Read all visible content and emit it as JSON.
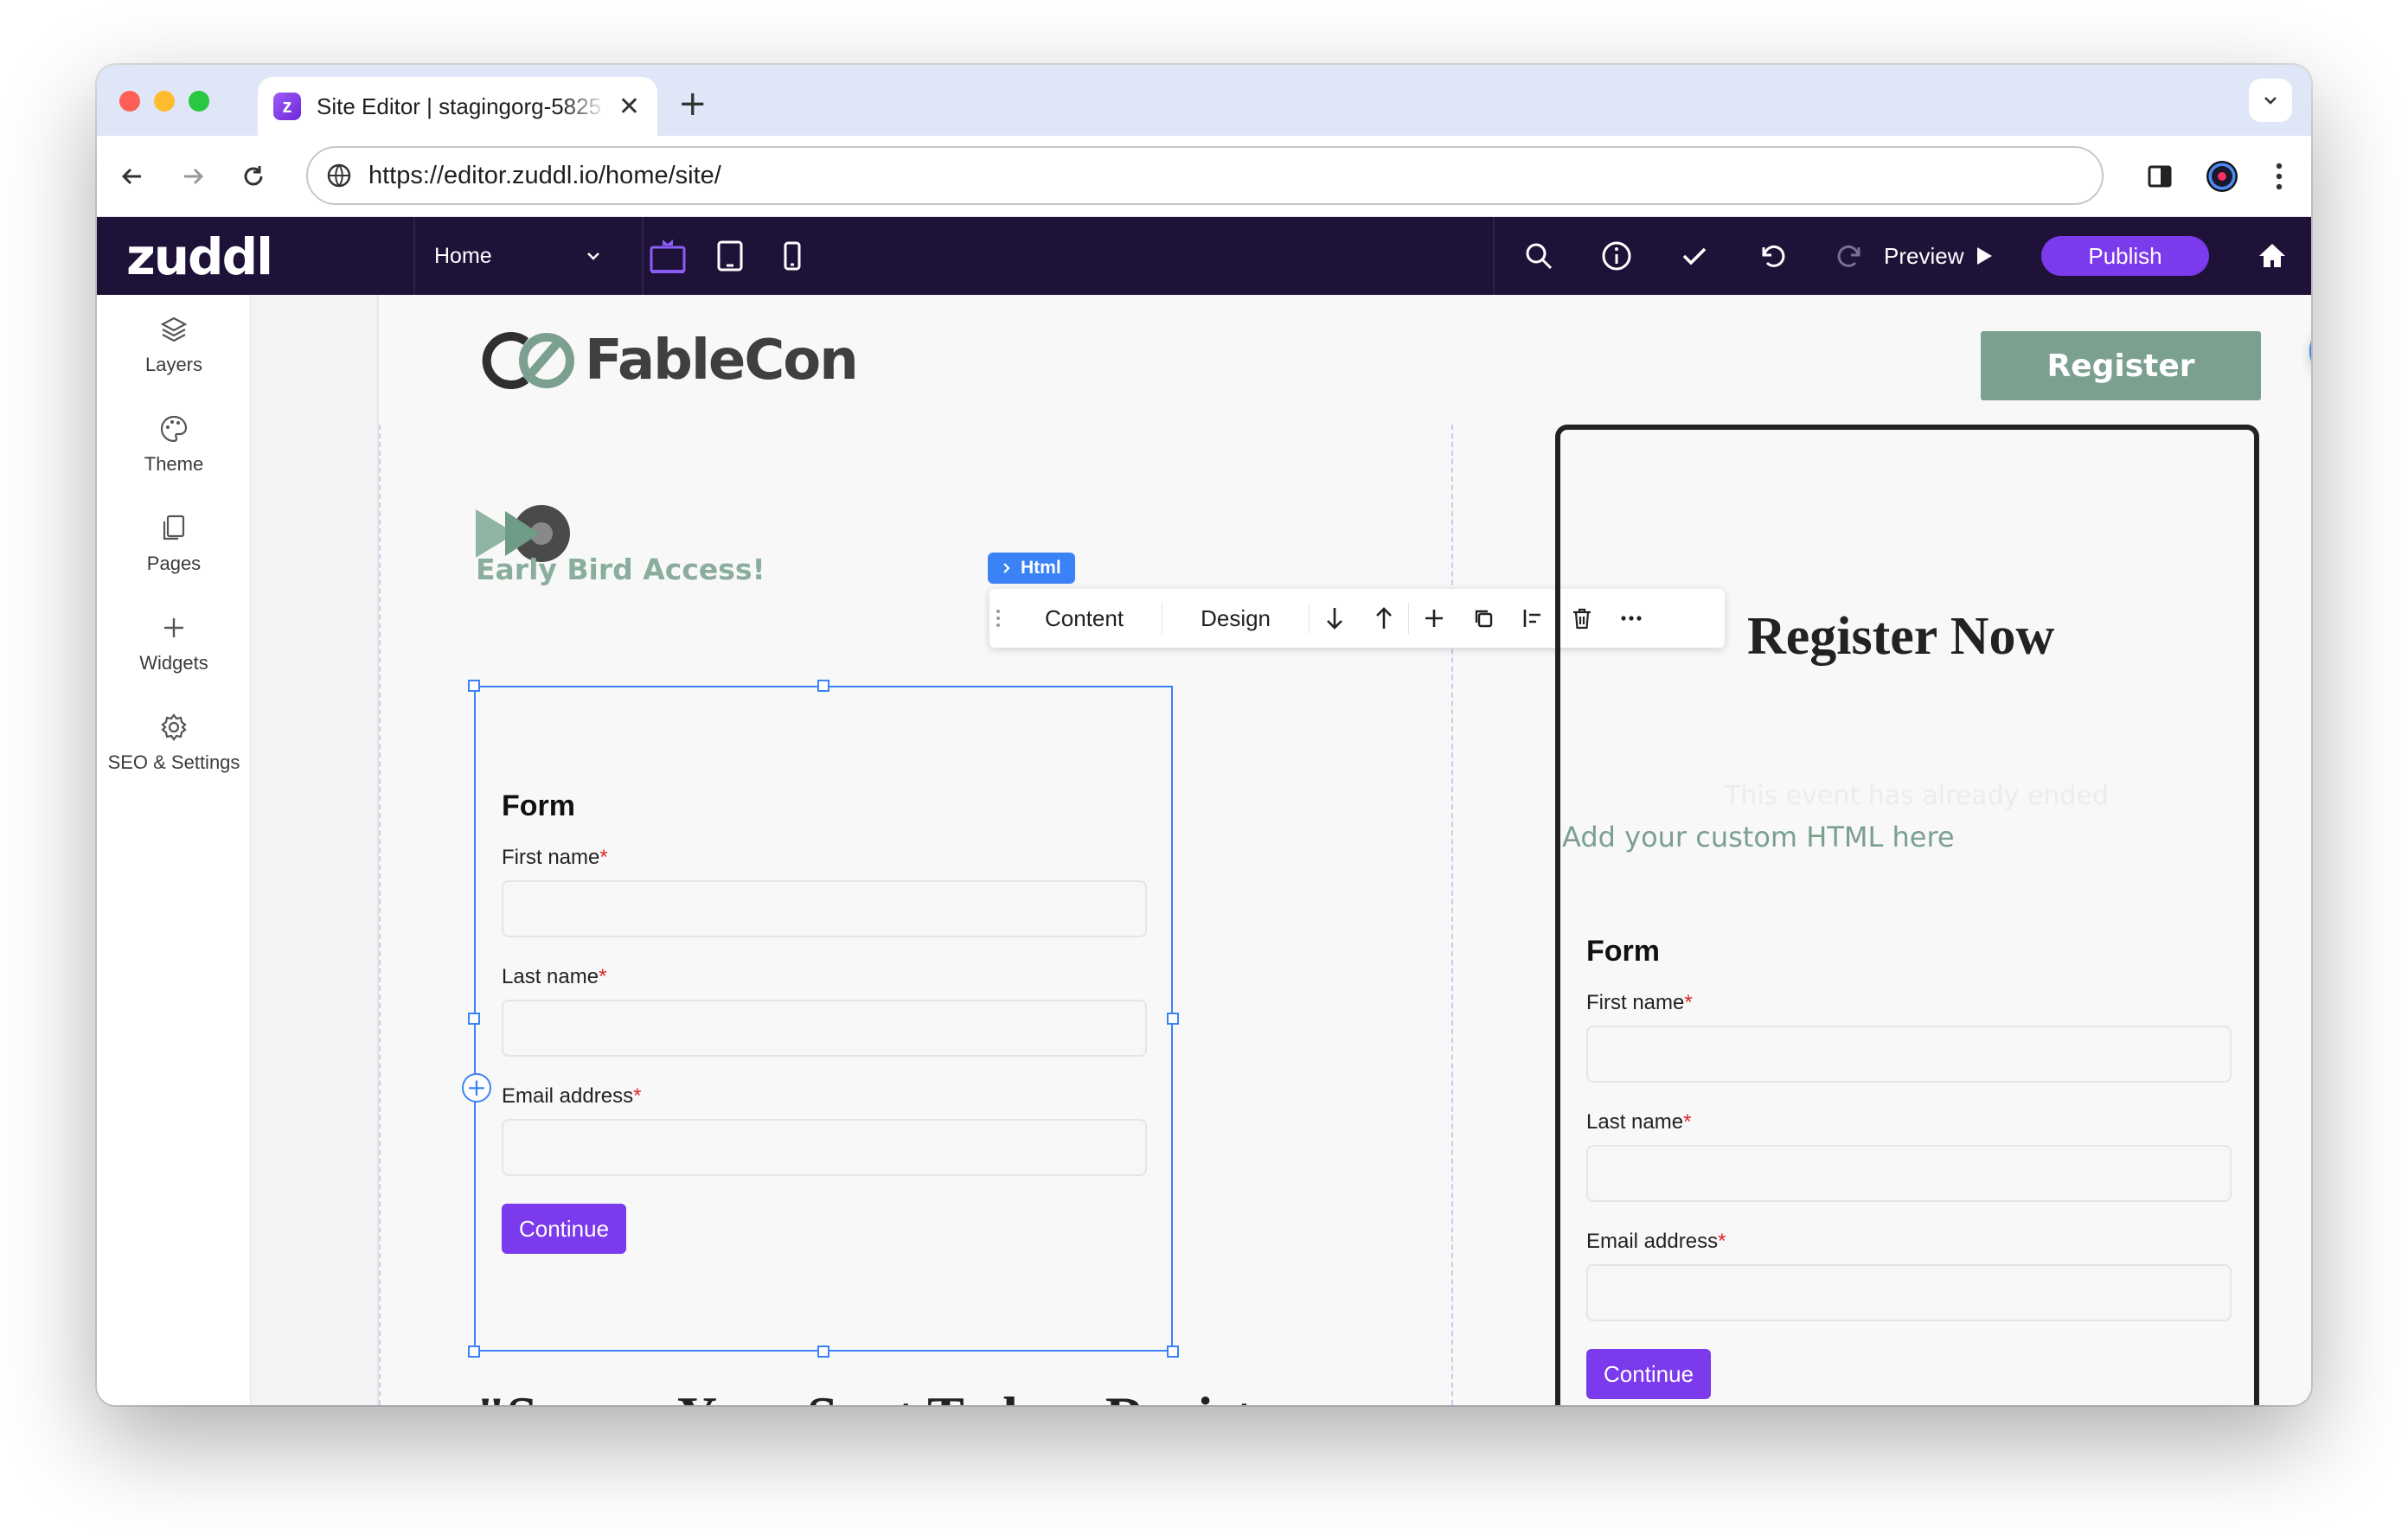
{
  "browser": {
    "tab_title": "Site Editor | stagingorg-5825",
    "url": "https://editor.zuddl.io/home/site/"
  },
  "app": {
    "logo": "zuddl",
    "page_select": "Home",
    "preview_label": "Preview",
    "publish_label": "Publish",
    "accent_color": "#7c3aed",
    "header_color": "#1f1238"
  },
  "sidebar": {
    "items": [
      {
        "label": "Layers",
        "icon": "layers-icon"
      },
      {
        "label": "Theme",
        "icon": "palette-icon"
      },
      {
        "label": "Pages",
        "icon": "pages-icon"
      },
      {
        "label": "Widgets",
        "icon": "plus-icon"
      },
      {
        "label": "SEO & Settings",
        "icon": "gear-icon"
      }
    ]
  },
  "site": {
    "brand": "FableCon",
    "register_button": "Register",
    "early_bird": "Early Bird Access!",
    "headline": "\"Secure Your Spot Today: Register",
    "register_now": "Register Now",
    "event_ended": "This event has already ended",
    "custom_html": "Add your custom HTML here",
    "brand_color": "#7ba08f"
  },
  "editor": {
    "element_tag": "Html",
    "tabs": [
      "Content",
      "Design"
    ]
  },
  "form": {
    "title": "Form",
    "fields": [
      {
        "label": "First name",
        "required": "*"
      },
      {
        "label": "Last name",
        "required": "*"
      },
      {
        "label": "Email address",
        "required": "*"
      }
    ],
    "continue": "Continue"
  }
}
